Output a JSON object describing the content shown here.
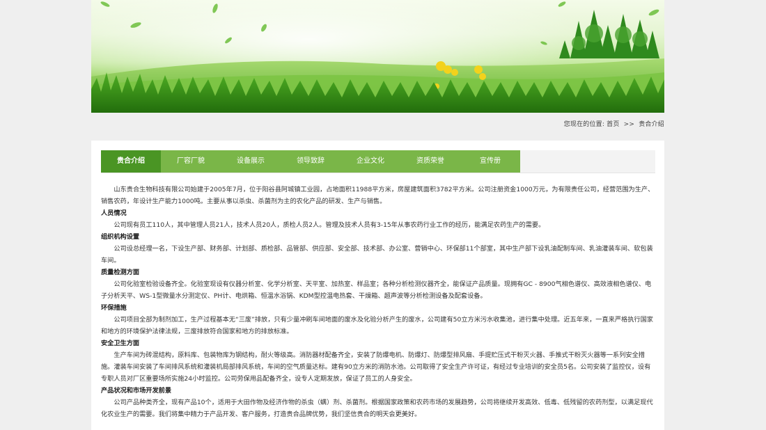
{
  "breadcrumb": {
    "prefix": "您现在的位置:",
    "home": "首页",
    "separator": ">>",
    "current": "贵合介绍"
  },
  "tabs": [
    {
      "label": "贵合介绍",
      "active": true
    },
    {
      "label": "厂容厂貌",
      "active": false
    },
    {
      "label": "设备展示",
      "active": false
    },
    {
      "label": "领导致辞",
      "active": false
    },
    {
      "label": "企业文化",
      "active": false
    },
    {
      "label": "资质荣誉",
      "active": false
    },
    {
      "label": "宣传册",
      "active": false
    }
  ],
  "content": {
    "intro": "山东贵合生物科技有限公司始建于2005年7月，位于阳谷县阿城镇工业园，占地面积11988平方米，房屋建筑面积3782平方米。公司注册资金1000万元，为有限责任公司，经营范围为生产、销售农药，年设计生产能力1000吨。主要从事以杀虫、杀菌剂为主的农化产品的研发、生产与销售。",
    "sections": [
      {
        "heading": "人员情况",
        "text": "公司现有员工110人，其中管理人员21人，技术人员20人，质检人员2人。管理及技术人员有3-15年从事农药行业工作的经历，能满足农药生产的需要。"
      },
      {
        "heading": "组织机构设置",
        "text": "公司设总经理一名，下设生产部、财务部、计划部、质检部、品管部、供应部、安全部、技术部、办公室、营销中心、环保部11个部室，其中生产部下设乳油配制车间、乳油灌装车间、软包装车间。"
      },
      {
        "heading": "质量检测方面",
        "text": "公司化验室检验设备齐全。化验室现设有仪器分析室、化学分析室、天平室、加热室、样品室；各种分析检测仪器齐全，能保证产品质量。现拥有GC - 8900气相色谱仪、高效液相色谱仪、电子分析天平、WS-1型微量水分测定仪、PH计、电烘箱、恒温水浴锅、KDM型控温电热套、干燥箱、超声波等分析检测设备及配套设备。"
      },
      {
        "heading": "环保措施",
        "text": "公司项目全部为制剂加工，生产过程基本无“三废”排放，只有少量冲刷车间地面的废水及化验分析产生的废水，公司建有50立方米污水收集池，进行集中处理。近五年来，一直来严格执行国家和地方的环境保护法律法规，三废排放符合国家和地方的排放标准。"
      },
      {
        "heading": "安全卫生方面",
        "text": "生产车间为砖混结构，原料库、包装物库为钢结构，耐火等级高。消防器材配备齐全，安装了防爆电机、防爆灯、防爆型排风扇、手提贮压式干粉灭火器、手推式干粉灭火器等一系列安全措施。灌装车间安装了车间排风系统和灌装机局部排风系统，车间的空气质量达标。建有90立方米的消防水池。公司取得了安全生产许可证，有经过专业培训的安全员5名。公司安装了监控仪，设有专职人员对厂区重要场所实施24小时监控。公司劳保用品配备齐全，设专人定期发放，保证了员工的人身安全。"
      },
      {
        "heading": "产品状况和市场开发前景",
        "text": "公司产品种类齐全，现有产品10个，适用于大田作物及经济作物的杀虫（螨）剂、杀菌剂。根据国家政策和农药市场的发展趋势，公司将继续开发高效、低毒、低残留的农药剂型，以满足现代化农业生产的需要。我们将集中精力于产品开发、客户服务，打造贵合品牌优势，我们坚信贵合的明天会更美好。"
      }
    ]
  },
  "colors": {
    "tab_active": "#4a9524",
    "tab_inactive": "#7ab648",
    "page_bg": "#efefef"
  }
}
